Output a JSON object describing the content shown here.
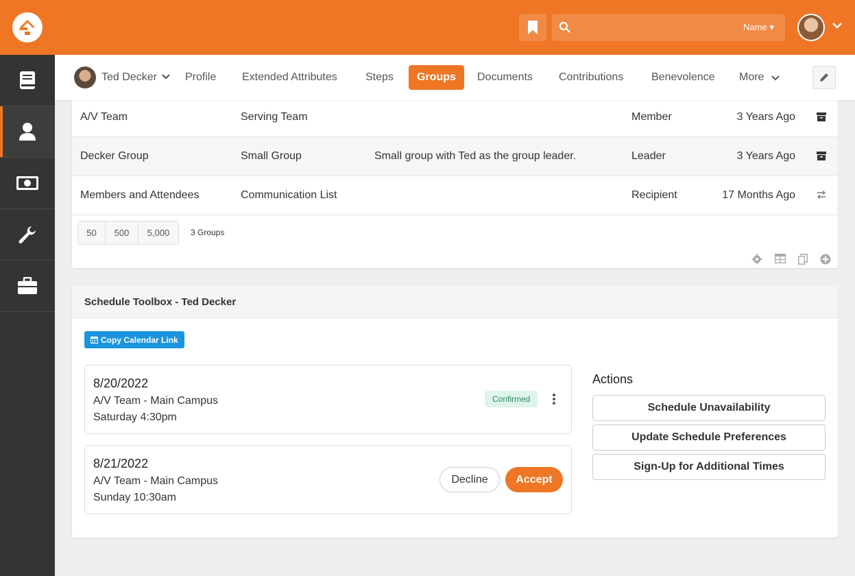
{
  "header": {
    "search_scope": "Name",
    "brand_color": "#ee7625"
  },
  "sidebar": {
    "items": [
      {
        "icon": "book-icon"
      },
      {
        "icon": "person-icon",
        "active": true
      },
      {
        "icon": "money-icon"
      },
      {
        "icon": "wrench-icon"
      },
      {
        "icon": "briefcase-icon"
      }
    ]
  },
  "person_nav": {
    "name": "Ted Decker",
    "tabs": [
      "Profile",
      "Extended Attributes",
      "Steps",
      "Groups",
      "Documents",
      "Contributions",
      "Benevolence",
      "More"
    ],
    "active_tab": "Groups"
  },
  "groups": {
    "rows": [
      {
        "name": "A/V Team",
        "type": "Serving Team",
        "description": "",
        "role": "Member",
        "date": "3 Years Ago",
        "icon": "archive-icon"
      },
      {
        "name": "Decker Group",
        "type": "Small Group",
        "description": "Small group with Ted as the group leader.",
        "role": "Leader",
        "date": "3 Years Ago",
        "icon": "archive-icon"
      },
      {
        "name": "Members and Attendees",
        "type": "Communication List",
        "description": "",
        "role": "Recipient",
        "date": "17 Months Ago",
        "icon": "exchange-icon"
      }
    ],
    "page_sizes": [
      "50",
      "500",
      "5,000"
    ],
    "count": "3 Groups"
  },
  "schedule": {
    "title": "Schedule Toolbox - Ted Decker",
    "copy_link_label": "Copy Calendar Link",
    "occurrences": [
      {
        "date": "8/20/2022",
        "location": "A/V Team - Main Campus",
        "time": "Saturday 4:30pm",
        "status": "Confirmed"
      },
      {
        "date": "8/21/2022",
        "location": "A/V Team - Main Campus",
        "time": "Sunday 10:30am",
        "decline_label": "Decline",
        "accept_label": "Accept"
      }
    ],
    "actions_title": "Actions",
    "actions": [
      "Schedule Unavailability",
      "Update Schedule Preferences",
      "Sign-Up for Additional Times"
    ]
  }
}
